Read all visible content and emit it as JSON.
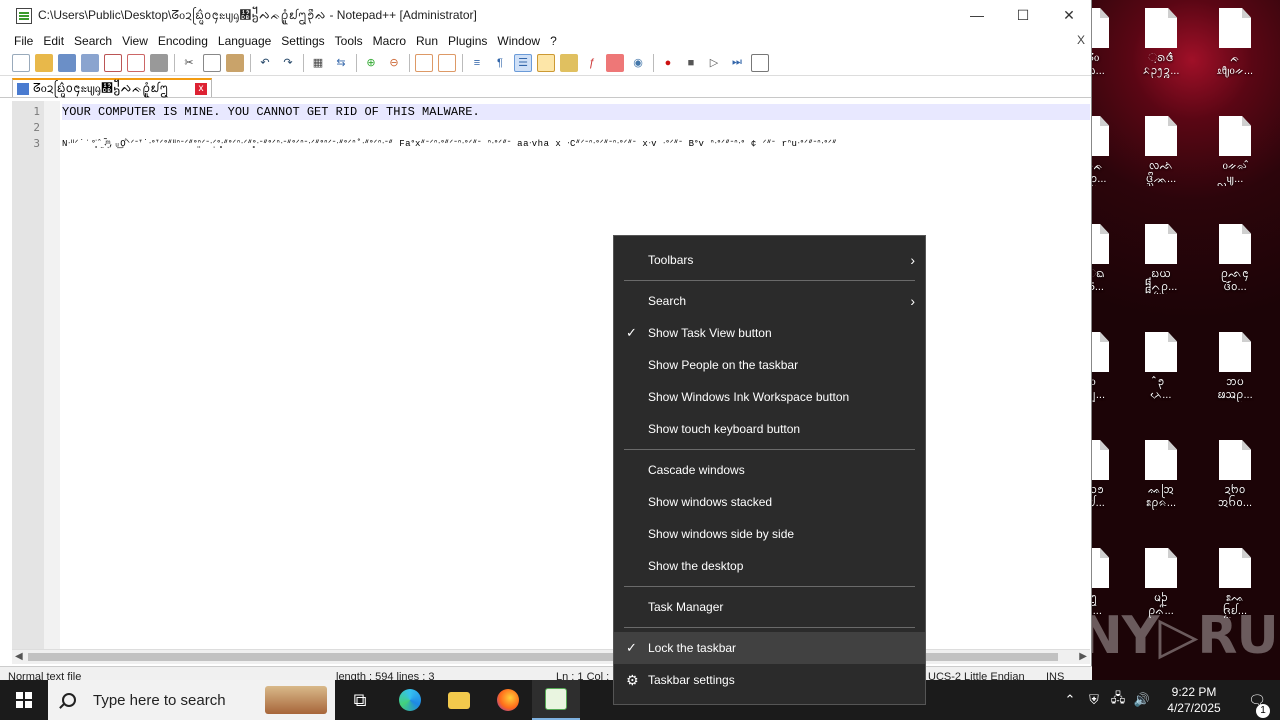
{
  "window": {
    "title": "C:\\Users\\Public\\Desktop\\ᘔ᧐ᨯᨭᩕᩜᩳ᪀᪄ᦰᦼᧂ᧛᧶ᨄᨃᩑᩪᩴ᪖ᩂ᪃ᩨᨁ - Notepad++ [Administrator]",
    "minimize": "—",
    "maximize": "☐",
    "close": "✕"
  },
  "menu": [
    "File",
    "Edit",
    "Search",
    "View",
    "Encoding",
    "Language",
    "Settings",
    "Tools",
    "Macro",
    "Run",
    "Plugins",
    "Window",
    "?"
  ],
  "menu_close": "X",
  "tab": {
    "label": "ᘔ᧐ᨯᨭᩕᩜᩳ᪀᪄ᦰᦼᧂ᧛᧶ᨄᨃᩑᩪᩴ᪖ᩂ",
    "close": "x"
  },
  "editor": {
    "line_numbers": [
      "1",
      "2",
      "3"
    ],
    "lines": [
      "YOUR COMPUTER IS MINE. YOU CANNOT GET RID OF THIS MALWARE.",
      "",
      "Nᐧᐦᐟ˙ˈ°̥̇ˆ̤˖ͫ̃ͅ,ᵤ̲Ọ̣̊ᐠᐟᐨᐪ˙ᐧᐤᐪᐟᐤᐥᐦᐢᐨᐟᐥᐤᐢ̤ᐟᐨᐧᐟ̣ᐤᐧ̥ᐥᐤᐟᐢᐧᐟᐥᐤ̥ᐧᐨᐥᐤᐟᐢᐧᐨᐥᐤᐟᐢᐨᐧᐟᐥᐤᐢᐟᐨᐧᐥᐤᐟᐢ˚ᐧᐥᐤᐟᐢᐧᐨᐥ Faᐤxᐥᐨᐟᐢᐧᐤᐥᐟᐨᐢᐧᐤᐟᐥᐨ ᐢᐧᐤᐟᐥᐨ aaᐧvha x ᐧCᐥᐟᐨᐢᐧᐤᐟᐥᐨᐢᐧᐤᐟᐥᐨ xᐧv ᐧᐤᐟᐥᐨ Bᐤv ᐢᐧᐤᐟᐥᐨᐢᐧᐤ ¢ ᐟᐥᐨ rᐢuᐧᐤᐟᐥᐨᐢᐧᐤᐟᐥ"
    ]
  },
  "status": {
    "left": "Normal text file",
    "length": "length : 594    lines : 3",
    "pos": "Ln : 1    Col : 1",
    "encoding": "UCS-2 Little Endian",
    "mode": "INS"
  },
  "desktop_icons": [
    {
      "label": "ᘔ᧐\nᨯᨭ..."
    },
    {
      "label": "ᨘᩁ᪕ᩳ\nᨅᩏ᪂ᩄ..."
    },
    {
      "label": "ᨃ\nᦸᦿ᧐ᨀ..."
    },
    {
      "label": "ᨄᨃ\nᩈᩑ..."
    },
    {
      "label": "ᩃᨒᨗ\nᨴᩚᩞᨏ..."
    },
    {
      "label": "᧐ᨀᨋ᩷\nᩖᦼ..."
    },
    {
      "label": "ᨙᨳ\nZ5..."
    },
    {
      "label": "ᨭᨿ\n᧰ᨈᩬᩑ..."
    },
    {
      "label": "ᩑᨒ᪄\nᨴ᩶ᩢ᪀..."
    },
    {
      "label": "ᩞ᧐\nᨫᩗ..."
    },
    {
      "label": "ᩳ᪃\nᨂᨙ..."
    },
    {
      "label": "ᨽᨷ\nᨹᩇᩑ..."
    },
    {
      "label": "ᩔ᪁\nᨶᩀ..."
    },
    {
      "label": "ᨐᩒ\nᩡᩑᨑ..."
    },
    {
      "label": "ᨯᨼ᪀\nᩋᨤᩅ..."
    },
    {
      "label": "ᩂ\nᨰ..."
    },
    {
      "label": "ᨾᩐ\nᩑᨊᩦ..."
    },
    {
      "label": "ᩡᨕ\nᨪᩬᩀ..."
    }
  ],
  "watermark": "ANY▷RUN",
  "taskbar": {
    "search_placeholder": "Type here to search",
    "time": "9:22 PM",
    "date": "4/27/2025",
    "notification_count": "1"
  },
  "context_menu": {
    "groups": [
      [
        {
          "label": "Toolbars",
          "checked": false,
          "submenu": true
        }
      ],
      [
        {
          "label": "Search",
          "checked": false,
          "submenu": true
        },
        {
          "label": "Show Task View button",
          "checked": true,
          "submenu": false
        },
        {
          "label": "Show People on the taskbar",
          "checked": false,
          "submenu": false
        },
        {
          "label": "Show Windows Ink Workspace button",
          "checked": false,
          "submenu": false
        },
        {
          "label": "Show touch keyboard button",
          "checked": false,
          "submenu": false
        }
      ],
      [
        {
          "label": "Cascade windows",
          "checked": false,
          "submenu": false
        },
        {
          "label": "Show windows stacked",
          "checked": false,
          "submenu": false
        },
        {
          "label": "Show windows side by side",
          "checked": false,
          "submenu": false
        },
        {
          "label": "Show the desktop",
          "checked": false,
          "submenu": false
        }
      ],
      [
        {
          "label": "Task Manager",
          "checked": false,
          "submenu": false
        }
      ],
      [
        {
          "label": "Lock the taskbar",
          "checked": true,
          "submenu": false,
          "hover": true
        },
        {
          "label": "Taskbar settings",
          "checked": false,
          "submenu": false,
          "gear": true
        }
      ]
    ]
  },
  "colors": {
    "menu_bg": "#2b2b2b",
    "menu_hover": "#414141",
    "taskbar_bg": "#1b1b1b",
    "tab_accent": "#f39c12",
    "current_line": "#e8e8ff"
  }
}
